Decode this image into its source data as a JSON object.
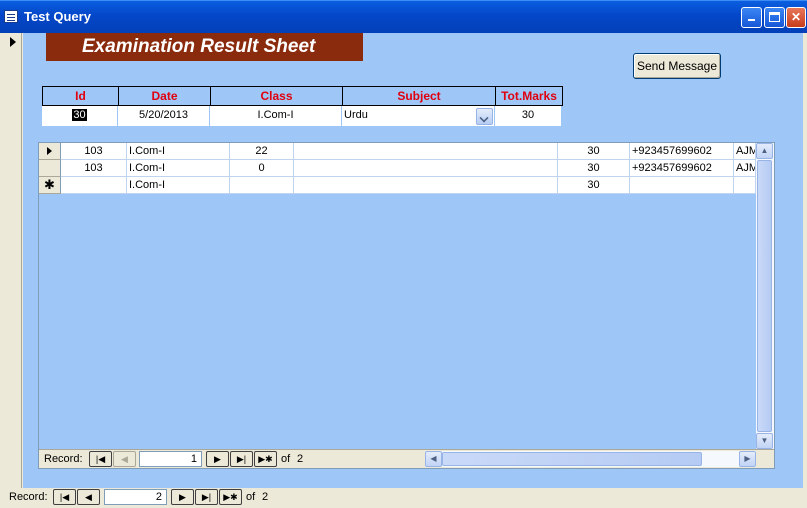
{
  "window": {
    "title": "Test Query",
    "buttons": {
      "minimize": "_",
      "maximize": "□",
      "close": "✕"
    }
  },
  "form": {
    "banner": "Examination Result Sheet",
    "send_message_label": "Send Message",
    "headers": {
      "id": "Id",
      "date": "Date",
      "class": "Class",
      "subject": "Subject",
      "tot_marks": "Tot.Marks"
    },
    "record": {
      "id": "30",
      "date": "5/20/2013",
      "class": "I.Com-I",
      "subject": "Urdu",
      "tot_marks": "30"
    }
  },
  "subform": {
    "rows": [
      {
        "roll": "103",
        "class": "I.Com-I",
        "marks": "22",
        "name": "",
        "total": "30",
        "phone": "+923457699602",
        "extra": "AJM",
        "current": true
      },
      {
        "roll": "103",
        "class": "I.Com-I",
        "marks": "0",
        "name": "",
        "total": "30",
        "phone": "+923457699602",
        "extra": "AJM",
        "current": false
      },
      {
        "roll": "",
        "class": "I.Com-I",
        "marks": "",
        "name": "",
        "total": "30",
        "phone": "",
        "extra": "",
        "new": true
      }
    ],
    "new_row_marker": "✱",
    "nav": {
      "label": "Record:",
      "current": "1",
      "of_label": "of",
      "total": "2"
    }
  },
  "main_nav": {
    "label": "Record:",
    "current": "2",
    "of_label": "of",
    "total": "2"
  },
  "colors": {
    "form_bg": "#9ec7f7",
    "banner_bg": "#8b2b0d",
    "header_text": "#e0000e",
    "titlebar": "#0447c9"
  },
  "icons": {
    "first": "first-record-icon",
    "prev": "prev-record-icon",
    "next": "next-record-icon",
    "last": "last-record-icon",
    "new": "new-record-icon"
  }
}
